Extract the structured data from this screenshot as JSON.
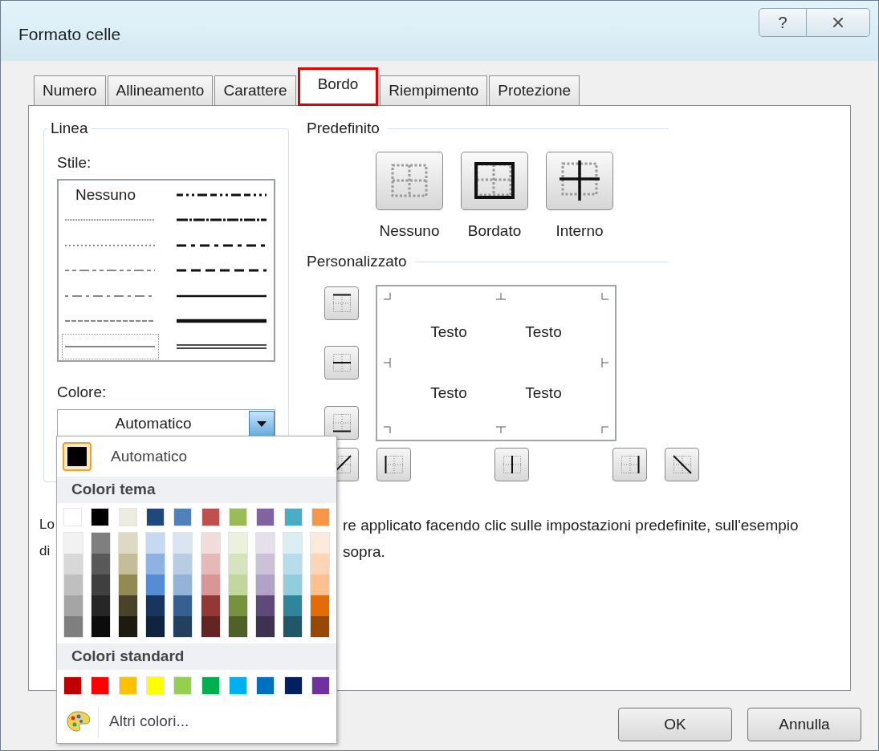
{
  "window": {
    "title": "Formato celle",
    "help_button": "?"
  },
  "tabs": [
    {
      "label": "Numero",
      "selected": false
    },
    {
      "label": "Allineamento",
      "selected": false
    },
    {
      "label": "Carattere",
      "selected": false
    },
    {
      "label": "Bordo",
      "selected": true
    },
    {
      "label": "Riempimento",
      "selected": false
    },
    {
      "label": "Protezione",
      "selected": false
    }
  ],
  "line_group": {
    "title": "Linea",
    "style_label": "Stile:",
    "styles": [
      {
        "kind": "text",
        "label": "Nessuno",
        "selected": false
      },
      {
        "kind": "line",
        "selected": false
      },
      {
        "kind": "line",
        "selected": false
      },
      {
        "kind": "line",
        "selected": false
      },
      {
        "kind": "line",
        "selected": false
      },
      {
        "kind": "line",
        "selected": false
      },
      {
        "kind": "line",
        "selected": true
      },
      {
        "kind": "line",
        "selected": false
      },
      {
        "kind": "line",
        "selected": false
      },
      {
        "kind": "line",
        "selected": false
      },
      {
        "kind": "line",
        "selected": false
      },
      {
        "kind": "line",
        "selected": false
      },
      {
        "kind": "line",
        "selected": false
      },
      {
        "kind": "line",
        "selected": false
      }
    ],
    "color_label": "Colore:",
    "color_value": "Automatico"
  },
  "presets": {
    "title": "Predefinito",
    "items": [
      {
        "kind": "none",
        "label": "Nessuno"
      },
      {
        "kind": "outline",
        "label": "Bordato"
      },
      {
        "kind": "inside",
        "label": "Interno"
      }
    ]
  },
  "custom": {
    "title": "Personalizzato",
    "side_buttons": [
      {
        "kind": "top"
      },
      {
        "kind": "hmid"
      },
      {
        "kind": "bottom"
      }
    ],
    "bottom_buttons": [
      {
        "kind": "diagup"
      },
      {
        "kind": "left"
      },
      {
        "kind": "vmid"
      },
      {
        "kind": "right"
      },
      {
        "kind": "diagdown"
      }
    ],
    "preview_texts": [
      "Testo",
      "Testo",
      "Testo",
      "Testo"
    ]
  },
  "description": [
    {
      "start": "Lo",
      "end": "re applicato facendo clic sulle impostazioni predefinite, sull'esempio"
    },
    {
      "start": "di",
      "end": "sopra."
    }
  ],
  "color_popup": {
    "automatic": {
      "label": "Automatico",
      "color": "#000000",
      "selected": true
    },
    "theme_title": "Colori tema",
    "theme_colors": [
      {
        "color": "#ffffff",
        "shades": [
          {
            "color": "#f2f2f2"
          },
          {
            "color": "#d8d8d8"
          },
          {
            "color": "#bfbfbf"
          },
          {
            "color": "#a5a5a5"
          },
          {
            "color": "#7f7f7f"
          }
        ]
      },
      {
        "color": "#000000",
        "shades": [
          {
            "color": "#7f7f7f"
          },
          {
            "color": "#595959"
          },
          {
            "color": "#3f3f3f"
          },
          {
            "color": "#262626"
          },
          {
            "color": "#0c0c0c"
          }
        ]
      },
      {
        "color": "#eeece1",
        "shades": [
          {
            "color": "#ddd9c3"
          },
          {
            "color": "#c4bd97"
          },
          {
            "color": "#938953"
          },
          {
            "color": "#494429"
          },
          {
            "color": "#1d1b10"
          }
        ]
      },
      {
        "color": "#1f497d",
        "shades": [
          {
            "color": "#c6d9f0"
          },
          {
            "color": "#8db3e2"
          },
          {
            "color": "#548dd4"
          },
          {
            "color": "#17365d"
          },
          {
            "color": "#0f243e"
          }
        ]
      },
      {
        "color": "#4f81bd",
        "shades": [
          {
            "color": "#dbe5f1"
          },
          {
            "color": "#b8cce4"
          },
          {
            "color": "#95b3d7"
          },
          {
            "color": "#366092"
          },
          {
            "color": "#244061"
          }
        ]
      },
      {
        "color": "#c0504d",
        "shades": [
          {
            "color": "#f2dcdb"
          },
          {
            "color": "#e5b9b7"
          },
          {
            "color": "#d99694"
          },
          {
            "color": "#953734"
          },
          {
            "color": "#632423"
          }
        ]
      },
      {
        "color": "#9bbb59",
        "shades": [
          {
            "color": "#ebf1dd"
          },
          {
            "color": "#d7e3bc"
          },
          {
            "color": "#c3d69b"
          },
          {
            "color": "#76923c"
          },
          {
            "color": "#4f6128"
          }
        ]
      },
      {
        "color": "#8064a2",
        "shades": [
          {
            "color": "#e5e0ec"
          },
          {
            "color": "#ccc1d9"
          },
          {
            "color": "#b2a2c7"
          },
          {
            "color": "#5f497a"
          },
          {
            "color": "#3f3151"
          }
        ]
      },
      {
        "color": "#4bacc6",
        "shades": [
          {
            "color": "#dbeef3"
          },
          {
            "color": "#b7dde8"
          },
          {
            "color": "#92cddc"
          },
          {
            "color": "#31859b"
          },
          {
            "color": "#205867"
          }
        ]
      },
      {
        "color": "#f79646",
        "shades": [
          {
            "color": "#fdeada"
          },
          {
            "color": "#fbd5b5"
          },
          {
            "color": "#fac08f"
          },
          {
            "color": "#e36c09"
          },
          {
            "color": "#974806"
          }
        ]
      }
    ],
    "standard_title": "Colori standard",
    "standard_colors": [
      {
        "color": "#c00000"
      },
      {
        "color": "#ff0000"
      },
      {
        "color": "#ffc000"
      },
      {
        "color": "#ffff00"
      },
      {
        "color": "#92d050"
      },
      {
        "color": "#00b050"
      },
      {
        "color": "#00b0f0"
      },
      {
        "color": "#0070c0"
      },
      {
        "color": "#002060"
      },
      {
        "color": "#7030a0"
      }
    ],
    "more_colors": "Altri colori..."
  },
  "buttons": [
    {
      "label": "OK"
    },
    {
      "label": "Annulla"
    }
  ]
}
